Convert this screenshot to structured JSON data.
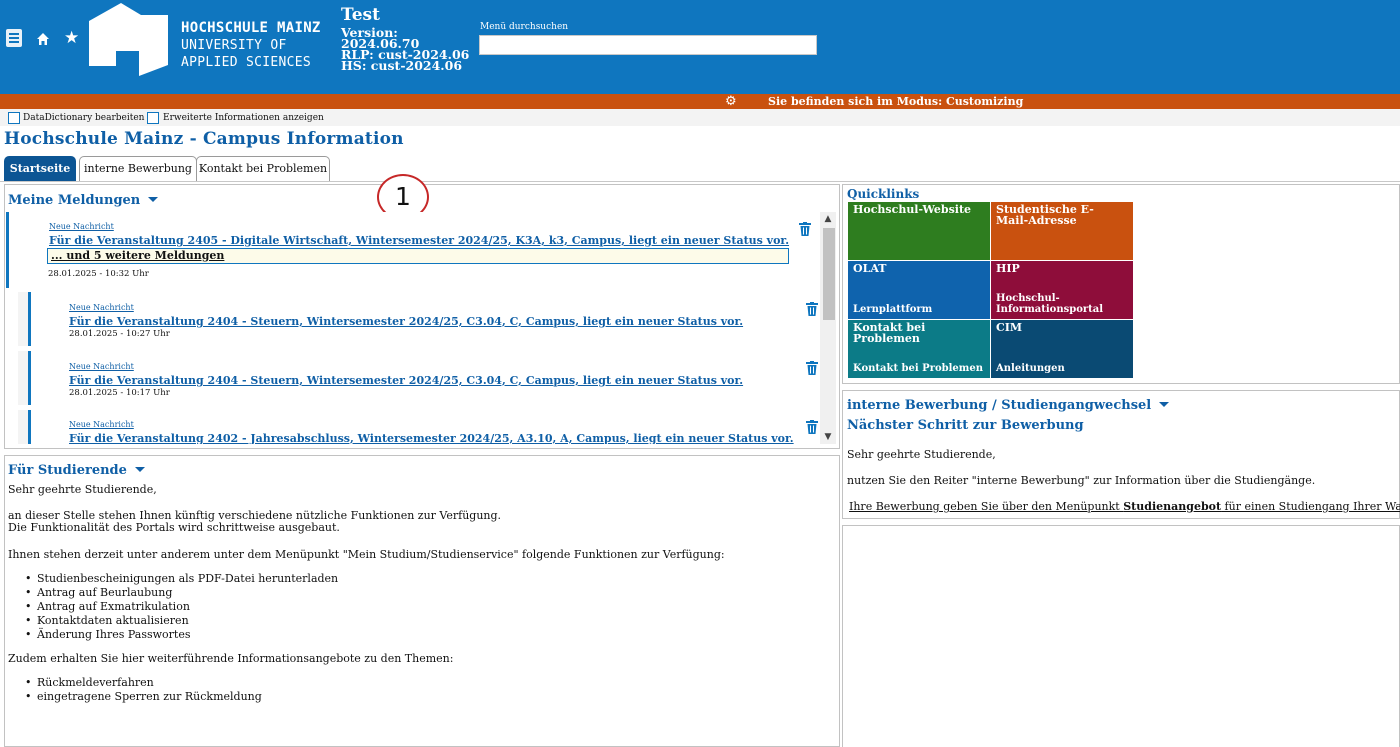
{
  "header": {
    "university_line1": "HOCHSCHULE MAINZ",
    "university_line2": "UNIVERSITY OF",
    "university_line3": "APPLIED SCIENCES",
    "env_title": "Test",
    "version_label": "Version:",
    "version_value": "2024.06.70",
    "rlp": "RLP: cust-2024.06",
    "hs": "HS: cust-2024.06",
    "search_label": "Menü durchsuchen",
    "search_value": ""
  },
  "modebar": {
    "text": "Sie befinden sich im Modus: Customizing"
  },
  "devbar": {
    "option1": "DataDictionary bearbeiten",
    "option2": "Erweiterte Informationen anzeigen"
  },
  "page_title": "Hochschule Mainz - Campus Information",
  "tabs": [
    {
      "label": "Startseite"
    },
    {
      "label": "interne Bewerbung"
    },
    {
      "label": "Kontakt bei Problemen"
    }
  ],
  "callout": "1",
  "meldungen": {
    "title": "Meine Meldungen",
    "more_label": "... und 5 weitere Meldungen",
    "items": [
      {
        "label": "Neue Nachricht",
        "text": "Für die Veranstaltung 2405 - Digitale Wirtschaft, Wintersemester 2024/25, K3A, k3, Campus, liegt ein neuer Status vor.",
        "date": "28.01.2025 - 10:32 Uhr"
      },
      {
        "label": "Neue Nachricht",
        "text": "Für die Veranstaltung 2404 - Steuern, Wintersemester 2024/25, C3.04, C, Campus, liegt ein neuer Status vor.",
        "date": "28.01.2025 - 10:27 Uhr"
      },
      {
        "label": "Neue Nachricht",
        "text": "Für die Veranstaltung 2404 - Steuern, Wintersemester 2024/25, C3.04, C, Campus, liegt ein neuer Status vor.",
        "date": "28.01.2025 - 10:17 Uhr"
      },
      {
        "label": "Neue Nachricht",
        "text": "Für die Veranstaltung 2402 - Jahresabschluss, Wintersemester 2024/25, A3.10, A, Campus, liegt ein neuer Status vor.",
        "date": ""
      }
    ]
  },
  "studierende": {
    "title": "Für Studierende",
    "greeting": "Sehr geehrte Studierende,",
    "p1_line1": "an dieser Stelle stehen Ihnen künftig verschiedene nützliche Funktionen zur Verfügung.",
    "p1_line2": "Die Funktionalität des Portals wird schrittweise ausgebaut.",
    "p2": "Ihnen stehen derzeit unter anderem unter dem Menüpunkt \"Mein Studium/Studienservice\" folgende Funktionen zur Verfügung:",
    "list1": [
      "Studienbescheinigungen als PDF-Datei herunterladen",
      "Antrag auf Beurlaubung",
      "Antrag auf Exmatrikulation",
      "Kontaktdaten aktualisieren",
      "Änderung Ihres Passwortes"
    ],
    "p3": "Zudem erhalten Sie hier weiterführende Informationsangebote zu den Themen:",
    "list2": [
      "Rückmeldeverfahren",
      "eingetragene Sperren zur Rückmeldung"
    ]
  },
  "quicklinks": {
    "title": "Quicklinks",
    "tiles": [
      {
        "title": "Hochschul-Website",
        "subtitle": "",
        "color": "#2e7d1f"
      },
      {
        "title": "Studentische E-Mail-Adresse",
        "subtitle": "",
        "color": "#c9510f"
      },
      {
        "title": "OLAT",
        "subtitle": "Lernplattform",
        "color": "#0f63ad"
      },
      {
        "title": "HIP",
        "subtitle": "Hochschul-Informationsportal",
        "color": "#8e0d3a"
      },
      {
        "title": "Kontakt bei Problemen",
        "subtitle": "Kontakt bei Problemen",
        "color": "#0c7b87"
      },
      {
        "title": "CIM",
        "subtitle": "Anleitungen",
        "color": "#0a4a73"
      }
    ]
  },
  "bewerbung": {
    "title": "interne Bewerbung / Studiengangwechsel",
    "subtitle": "Nächster Schritt zur Bewerbung",
    "greeting": "Sehr geehrte Studierende,",
    "line1": "nutzen Sie den Reiter \"interne Bewerbung\" zur Information über die Studiengänge.",
    "line2_pre": "Ihre Bewerbung geben Sie über den Menüpunkt ",
    "line2_bold": "Studienangebot",
    "line2_post": " für einen Studiengang Ihrer Wahl ab."
  }
}
